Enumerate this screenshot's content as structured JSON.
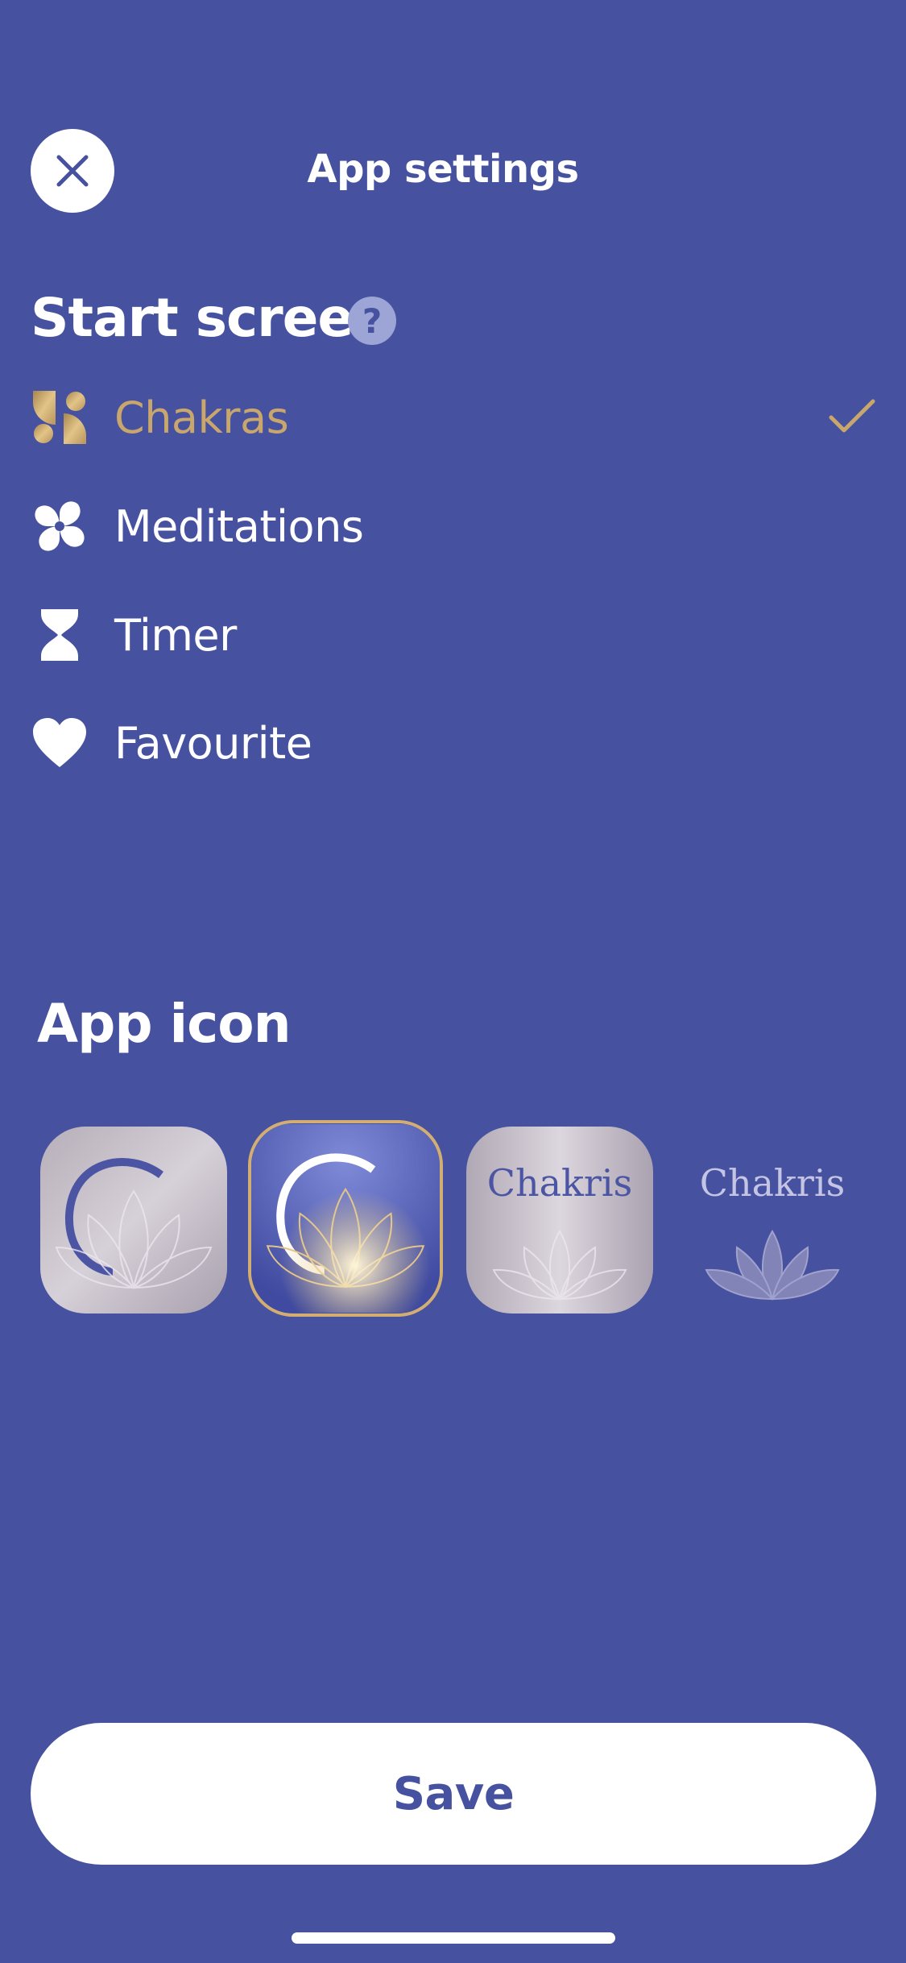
{
  "header": {
    "title": "App settings",
    "close_icon": "close-icon"
  },
  "start_screen": {
    "title": "Start screen",
    "help_label": "?",
    "options": [
      {
        "label": "Chakras",
        "icon": "chakras-icon",
        "selected": true
      },
      {
        "label": "Meditations",
        "icon": "meditations-icon",
        "selected": false
      },
      {
        "label": "Timer",
        "icon": "hourglass-icon",
        "selected": false
      },
      {
        "label": "Favourite",
        "icon": "heart-icon",
        "selected": false
      }
    ]
  },
  "app_icon": {
    "title": "App icon",
    "options": [
      {
        "variant": "silver-lotus-c",
        "text": "",
        "selected": false
      },
      {
        "variant": "gold-lotus-c",
        "text": "",
        "selected": true
      },
      {
        "variant": "silver-chakris",
        "text": "Chakris",
        "selected": false
      },
      {
        "variant": "transparent-chakris",
        "text": "Chakris",
        "selected": false
      }
    ]
  },
  "footer": {
    "save_label": "Save"
  },
  "colors": {
    "background": "#4651a0",
    "accent_gold": "#c9a66b",
    "white": "#ffffff"
  }
}
